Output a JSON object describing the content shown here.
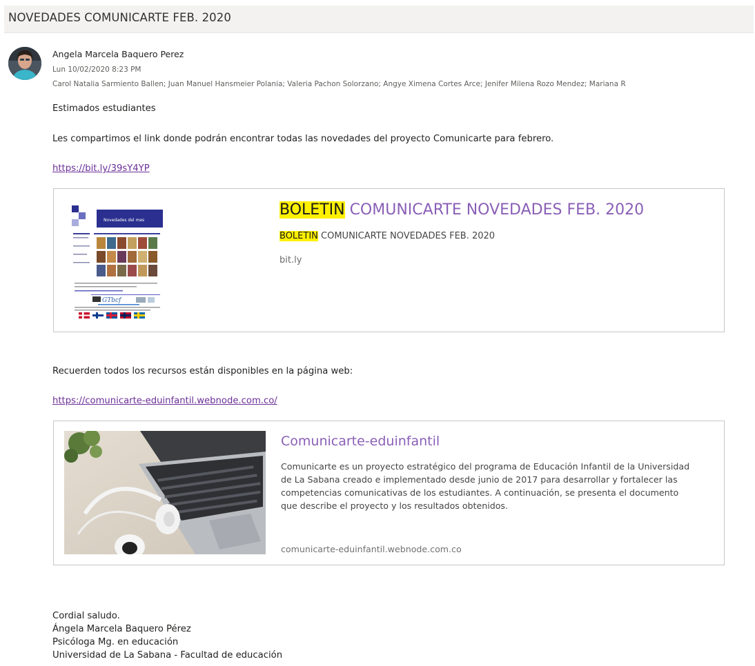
{
  "email": {
    "subject": "NOVEDADES COMUNICARTE FEB. 2020",
    "sender": "Angela Marcela Baquero Perez",
    "date": "Lun 10/02/2020 8:23 PM",
    "recipients": "Carol Natalia Sarmiento Ballen; Juan Manuel Hansmeier Polania; Valeria Pachon Solorzano; Angye Ximena Cortes Arce; Jenifer Milena Rozo Mendez; Mariana R"
  },
  "body": {
    "greeting": "Estimados estudiantes",
    "intro": "Les compartimos el link donde podrán encontrar todas las novedades del proyecto Comunicarte para febrero.",
    "link1": "https://bit.ly/39sY4YP",
    "reminder": "Recuerden todos los recursos están disponibles en la página web:",
    "link2": "https://comunicarte-eduinfantil.webnode.com.co/"
  },
  "card1": {
    "title_highlight": "BOLETIN",
    "title_rest": " COMUNICARTE NOVEDADES FEB. 2020",
    "sub_highlight": "BOLETIN",
    "sub_rest": " COMUNICARTE NOVEDADES FEB. 2020",
    "domain": "bit.ly",
    "thumb_heading": "Novedades del mes"
  },
  "card2": {
    "title": "Comunicarte-eduinfantil",
    "description": "Comunicarte es un proyecto estratégico del programa de Educación Infantil de la Universidad de La Sabana creado e implementado desde junio de 2017 para desarrollar y fortalecer las competencias comunicativas de los estudiantes. A continuación, se presenta el documento que describe el proyecto y los resultados obtenidos.",
    "domain": "comunicarte-eduinfantil.webnode.com.co"
  },
  "signature": {
    "closing": "Cordial saludo.",
    "name": "Ángela Marcela Baquero Pérez",
    "role": "Psicóloga Mg. en educación",
    "org": "Universidad de La Sabana - Facultad de educación"
  },
  "colors": {
    "link": "#6b2f97",
    "card_title": "#8a5fb6",
    "highlight": "#fff100"
  }
}
